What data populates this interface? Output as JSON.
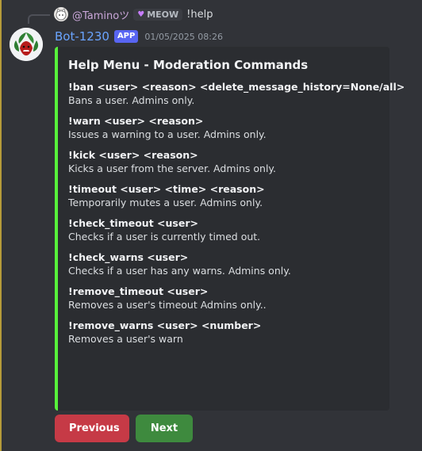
{
  "reply": {
    "username": "@Taminoツ",
    "tag": "MEOW",
    "content": "!help"
  },
  "message": {
    "author": "Bot-1230",
    "badge": "APP",
    "timestamp": "01/05/2025 08:26"
  },
  "embed": {
    "accent_color": "#57f23b",
    "title": "Help Menu - Moderation Commands",
    "fields": [
      {
        "name": "!ban <user> <reason> <delete_message_history=None/all>",
        "value": "Bans a user. Admins only."
      },
      {
        "name": "!warn <user> <reason>",
        "value": "Issues a warning to a user. Admins only."
      },
      {
        "name": "!kick <user> <reason>",
        "value": "Kicks a user from the server. Admins only."
      },
      {
        "name": "!timeout <user> <time> <reason>",
        "value": "Temporarily mutes a user. Admins only."
      },
      {
        "name": "!check_timeout <user>",
        "value": "Checks if a user is currently timed out."
      },
      {
        "name": "!check_warns <user>",
        "value": "Checks if a user has any warns. Admins only."
      },
      {
        "name": "!remove_timeout <user>",
        "value": "Removes a user's timeout Admins only.."
      },
      {
        "name": "!remove_warns <user> <number>",
        "value": "Removes a user's warn"
      }
    ]
  },
  "buttons": {
    "previous": "Previous",
    "next": "Next"
  }
}
